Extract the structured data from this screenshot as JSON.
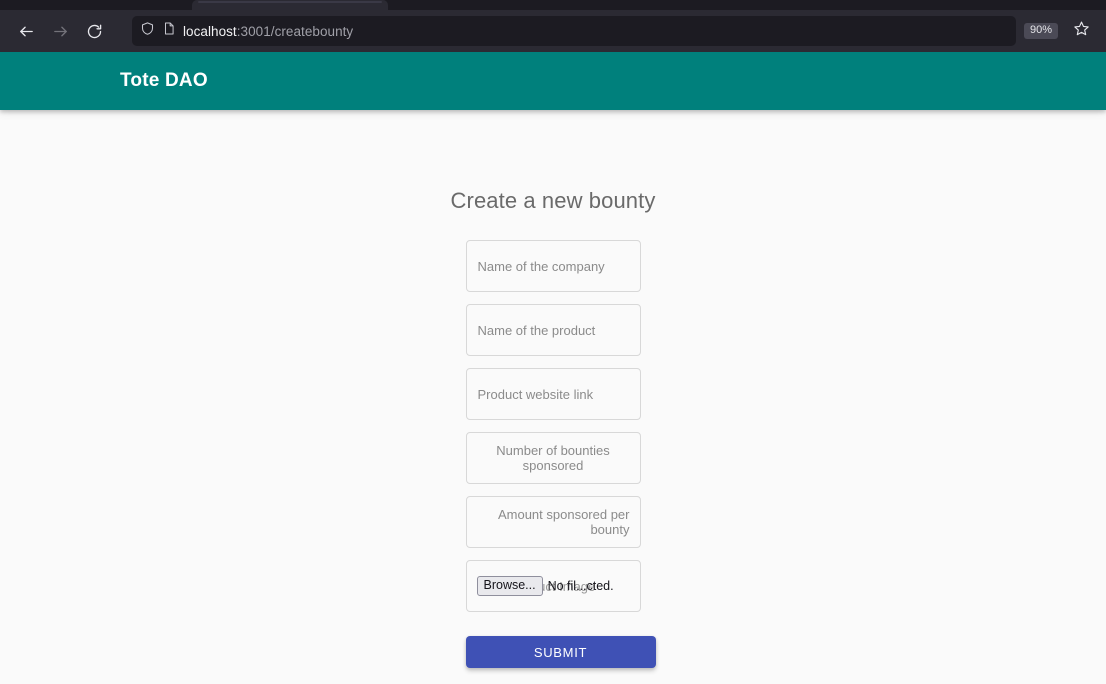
{
  "browser": {
    "back_icon": "arrow-left-icon",
    "forward_icon": "arrow-right-icon",
    "reload_icon": "reload-icon",
    "shield_icon": "shield-icon",
    "page_icon": "page-document-icon",
    "url_host": "localhost",
    "url_rest": ":3001/createbounty",
    "zoom_level": "90%",
    "bookmark_icon": "star-outline-icon"
  },
  "colors": {
    "appbar_teal": "#00807c",
    "submit_indigo": "#3f51b5",
    "page_background": "#fafafa",
    "placeholder_gray": "#8b8b8b",
    "heading_gray": "#6a6a6a",
    "chrome_dark": "#2b2a33"
  },
  "appbar": {
    "title": "Tote DAO"
  },
  "page": {
    "heading": "Create a new bounty"
  },
  "form": {
    "fields": [
      {
        "name": "company-name-field",
        "placeholder": "Name of the company",
        "align": "left",
        "type": "text"
      },
      {
        "name": "product-name-field",
        "placeholder": "Name of the product",
        "align": "left",
        "type": "text"
      },
      {
        "name": "product-link-field",
        "placeholder": "Product website link",
        "align": "left",
        "type": "text"
      },
      {
        "name": "bounty-count-field",
        "placeholder": "Number of bounties sponsored",
        "align": "right",
        "type": "number"
      },
      {
        "name": "bounty-amount-field",
        "placeholder": "Amount sponsored per bounty",
        "align": "right",
        "type": "number"
      }
    ],
    "file_field": {
      "placeholder": "Product Image",
      "browse_label": "Browse...",
      "status_label": "No fil...cted."
    },
    "submit_label": "SUBMIT"
  }
}
